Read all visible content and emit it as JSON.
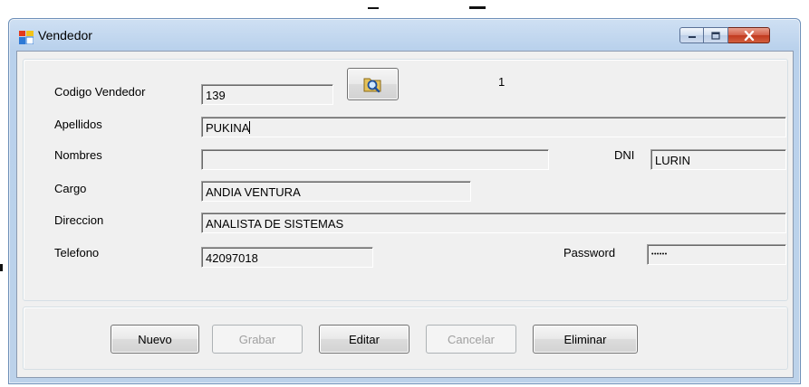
{
  "window": {
    "title": "Vendedor"
  },
  "form": {
    "codigo_label": "Codigo Vendedor",
    "codigo_value": "139",
    "record_indicator": "1",
    "apellidos_label": "Apellidos",
    "apellidos_value": "PUKINA",
    "nombres_label": "Nombres",
    "nombres_value": "",
    "dni_label": "DNI",
    "dni_value": "LURIN",
    "cargo_label": "Cargo",
    "cargo_value": "ANDIA VENTURA",
    "direccion_label": "Direccion",
    "direccion_value": "ANALISTA DE SISTEMAS",
    "telefono_label": "Telefono",
    "telefono_value": "42097018",
    "password_label": "Password",
    "password_value": "••••••"
  },
  "buttons": {
    "nuevo": "Nuevo",
    "grabar": "Grabar",
    "editar": "Editar",
    "cancelar": "Cancelar",
    "eliminar": "Eliminar"
  },
  "icons": {
    "app": "form-window-icon",
    "search": "search-folder-icon",
    "minimize": "minimize-icon",
    "maximize": "maximize-icon",
    "close": "close-icon"
  },
  "colors": {
    "title_bar": "#bcd2ea",
    "client_bg": "#f0f0f0",
    "close_button": "#c1391f",
    "disabled_text": "#a0a0a0"
  }
}
